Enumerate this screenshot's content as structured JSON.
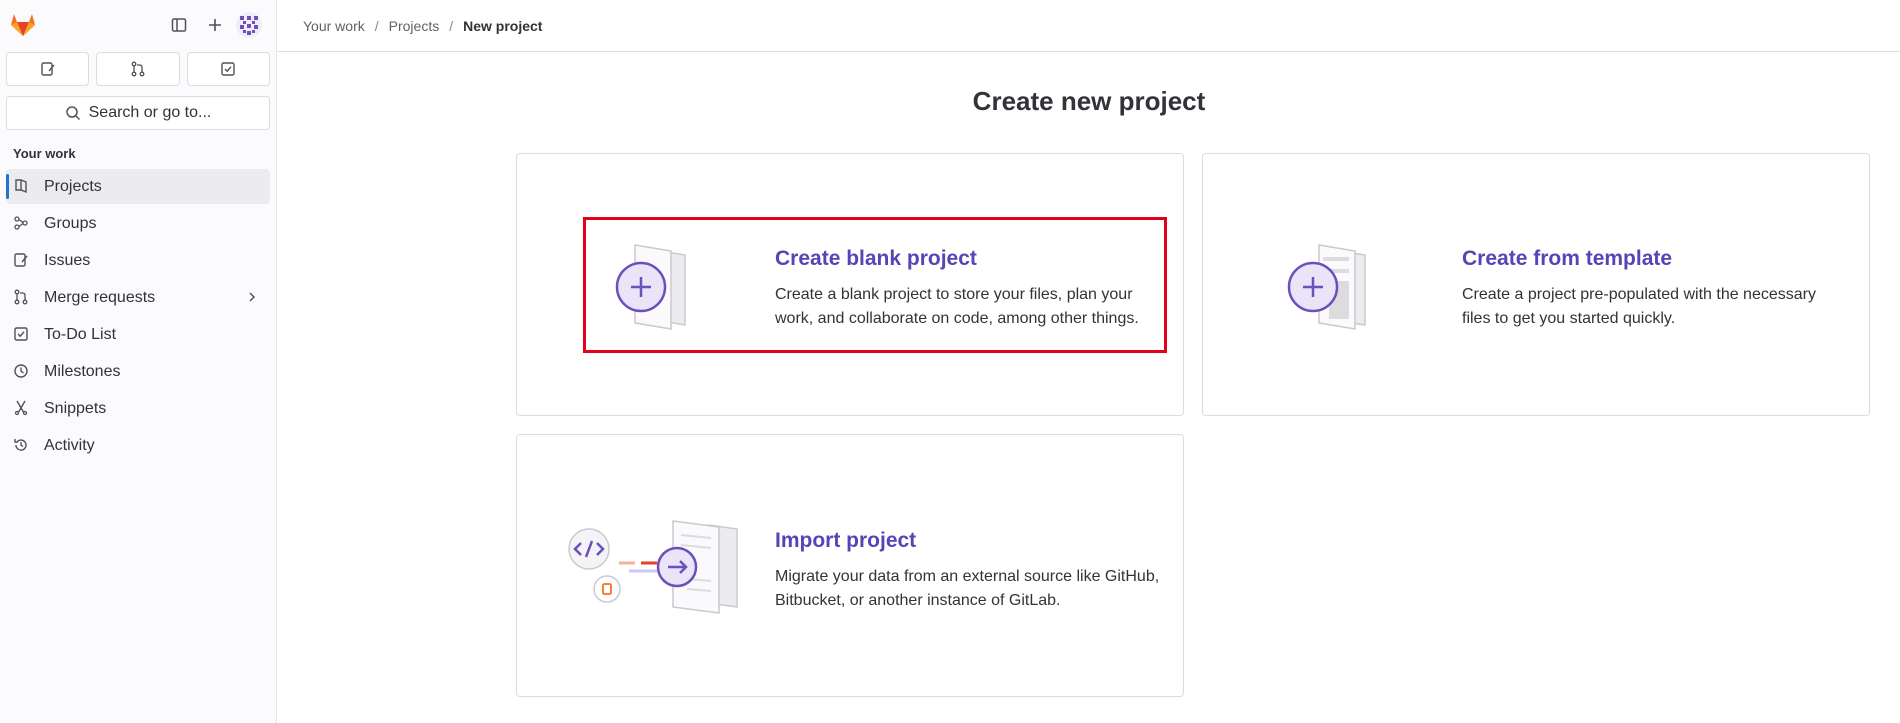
{
  "breadcrumb": {
    "items": [
      "Your work",
      "Projects"
    ],
    "current": "New project"
  },
  "search": {
    "label": "Search or go to..."
  },
  "sidebar": {
    "section_title": "Your work",
    "items": [
      {
        "label": "Projects",
        "icon": "project-icon",
        "active": true
      },
      {
        "label": "Groups",
        "icon": "group-icon"
      },
      {
        "label": "Issues",
        "icon": "issues-icon"
      },
      {
        "label": "Merge requests",
        "icon": "merge-request-icon",
        "has_submenu": true
      },
      {
        "label": "To-Do List",
        "icon": "todo-icon"
      },
      {
        "label": "Milestones",
        "icon": "clock-icon"
      },
      {
        "label": "Snippets",
        "icon": "snippet-icon"
      },
      {
        "label": "Activity",
        "icon": "history-icon"
      }
    ]
  },
  "main": {
    "title": "Create new project",
    "cards": [
      {
        "title": "Create blank project",
        "line1": "Create a blank project to store your files, plan your",
        "line2": "work, and collaborate on code, among other things."
      },
      {
        "title": "Create from template",
        "line1": "Create a project pre-populated with the necessary",
        "line2": "files to get you started quickly."
      },
      {
        "title": "Import project",
        "line1": "Migrate your data from an external source like GitHub,",
        "line2": "Bitbucket, or another instance of GitLab."
      }
    ]
  },
  "colors": {
    "accent": "#5943b6",
    "highlight": "#e3001b",
    "active_bar": "#1f75cb"
  }
}
